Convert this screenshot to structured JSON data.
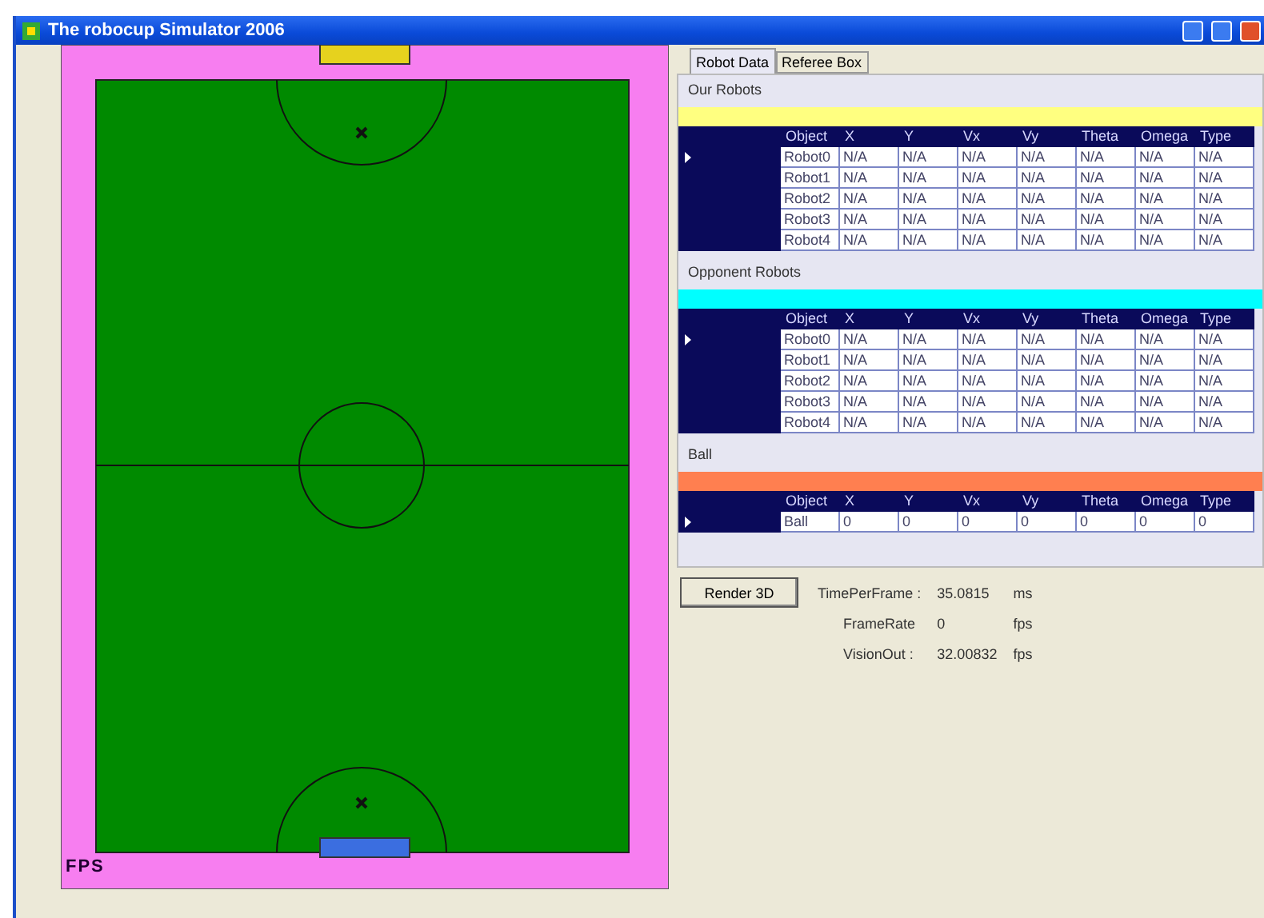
{
  "window": {
    "title": "The robocup Simulator 2006"
  },
  "field": {
    "label": "FPS",
    "goals": [
      {
        "color": "#e6d21e"
      },
      {
        "color": "#3b6ee0"
      }
    ]
  },
  "tabs": [
    {
      "label": "Robot Data",
      "selected": true
    },
    {
      "label": "Referee Box",
      "selected": false
    }
  ],
  "sections": [
    {
      "title": "Our Robots",
      "color": "#ffff80",
      "columns": [
        "Object",
        "X",
        "Y",
        "Vx",
        "Vy",
        "Theta",
        "Omega",
        "Type"
      ],
      "rows": [
        {
          "selected": true,
          "cells": [
            "Robot0",
            "N/A",
            "N/A",
            "N/A",
            "N/A",
            "N/A",
            "N/A",
            "N/A"
          ]
        },
        {
          "selected": false,
          "cells": [
            "Robot1",
            "N/A",
            "N/A",
            "N/A",
            "N/A",
            "N/A",
            "N/A",
            "N/A"
          ]
        },
        {
          "selected": false,
          "cells": [
            "Robot2",
            "N/A",
            "N/A",
            "N/A",
            "N/A",
            "N/A",
            "N/A",
            "N/A"
          ]
        },
        {
          "selected": false,
          "cells": [
            "Robot3",
            "N/A",
            "N/A",
            "N/A",
            "N/A",
            "N/A",
            "N/A",
            "N/A"
          ]
        },
        {
          "selected": false,
          "cells": [
            "Robot4",
            "N/A",
            "N/A",
            "N/A",
            "N/A",
            "N/A",
            "N/A",
            "N/A"
          ]
        }
      ]
    },
    {
      "title": "Opponent Robots",
      "color": "#00ffff",
      "columns": [
        "Object",
        "X",
        "Y",
        "Vx",
        "Vy",
        "Theta",
        "Omega",
        "Type"
      ],
      "rows": [
        {
          "selected": true,
          "cells": [
            "Robot0",
            "N/A",
            "N/A",
            "N/A",
            "N/A",
            "N/A",
            "N/A",
            "N/A"
          ]
        },
        {
          "selected": false,
          "cells": [
            "Robot1",
            "N/A",
            "N/A",
            "N/A",
            "N/A",
            "N/A",
            "N/A",
            "N/A"
          ]
        },
        {
          "selected": false,
          "cells": [
            "Robot2",
            "N/A",
            "N/A",
            "N/A",
            "N/A",
            "N/A",
            "N/A",
            "N/A"
          ]
        },
        {
          "selected": false,
          "cells": [
            "Robot3",
            "N/A",
            "N/A",
            "N/A",
            "N/A",
            "N/A",
            "N/A",
            "N/A"
          ]
        },
        {
          "selected": false,
          "cells": [
            "Robot4",
            "N/A",
            "N/A",
            "N/A",
            "N/A",
            "N/A",
            "N/A",
            "N/A"
          ]
        }
      ]
    },
    {
      "title": "Ball",
      "color": "#ff7f50",
      "columns": [
        "Object",
        "X",
        "Y",
        "Vx",
        "Vy",
        "Theta",
        "Omega",
        "Type"
      ],
      "rows": [
        {
          "selected": true,
          "cells": [
            "Ball",
            "0",
            "0",
            "0",
            "0",
            "0",
            "0",
            "0"
          ]
        }
      ]
    }
  ],
  "render_button": "Render 3D",
  "stats": [
    {
      "label": "TimePerFrame :",
      "value": "35.0815",
      "unit": "ms"
    },
    {
      "label": "FrameRate",
      "value": "0",
      "unit": "fps"
    },
    {
      "label": "VisionOut :",
      "value": "32.00832",
      "unit": "fps"
    }
  ]
}
